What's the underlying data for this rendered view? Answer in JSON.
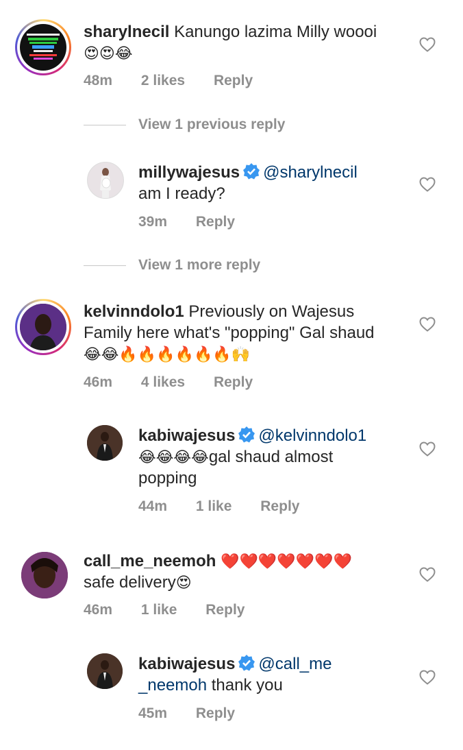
{
  "comments": [
    {
      "username": "sharylnecil",
      "text": "Kanungo lazima Milly woooi",
      "emoji_line": "😍😍😂",
      "time": "48m",
      "likes": "2 likes",
      "reply": "Reply"
    },
    {
      "view_label": "View 1 previous reply"
    },
    {
      "username": "millywajesus",
      "mention": "@sharylnecil",
      "text": "am I ready?",
      "time": "39m",
      "reply": "Reply"
    },
    {
      "view_label": "View 1 more reply"
    },
    {
      "username": "kelvinndolo1",
      "text1": "Previously on Wajesus",
      "text2": "Family here what's \"popping\" Gal shaud",
      "emoji_line": "😂😂🔥🔥🔥🔥🔥🔥🙌",
      "time": "46m",
      "likes": "4 likes",
      "reply": "Reply"
    },
    {
      "username": "kabiwajesus",
      "mention": "@kelvinndolo1",
      "emoji_prefix": "😂😂😂😂",
      "text1": "gal shaud almost",
      "text2": "popping",
      "time": "44m",
      "likes": "1 like",
      "reply": "Reply"
    },
    {
      "username": "call_me_neemoh",
      "emoji_after": "❤️❤️❤️❤️❤️❤️❤️",
      "text": "safe delivery",
      "emoji_end": "😍",
      "time": "46m",
      "likes": "1 like",
      "reply": "Reply"
    },
    {
      "username": "kabiwajesus",
      "mention1": "@call_me",
      "mention2": "_neemoh",
      "text": "thank you",
      "time": "45m",
      "reply": "Reply"
    }
  ],
  "icons": {
    "like": "heart-outline-icon",
    "verified": "verified-badge-icon"
  },
  "colors": {
    "text": "#262626",
    "meta": "#8e8e8e",
    "mention": "#00376b",
    "verified": "#3897f0"
  }
}
